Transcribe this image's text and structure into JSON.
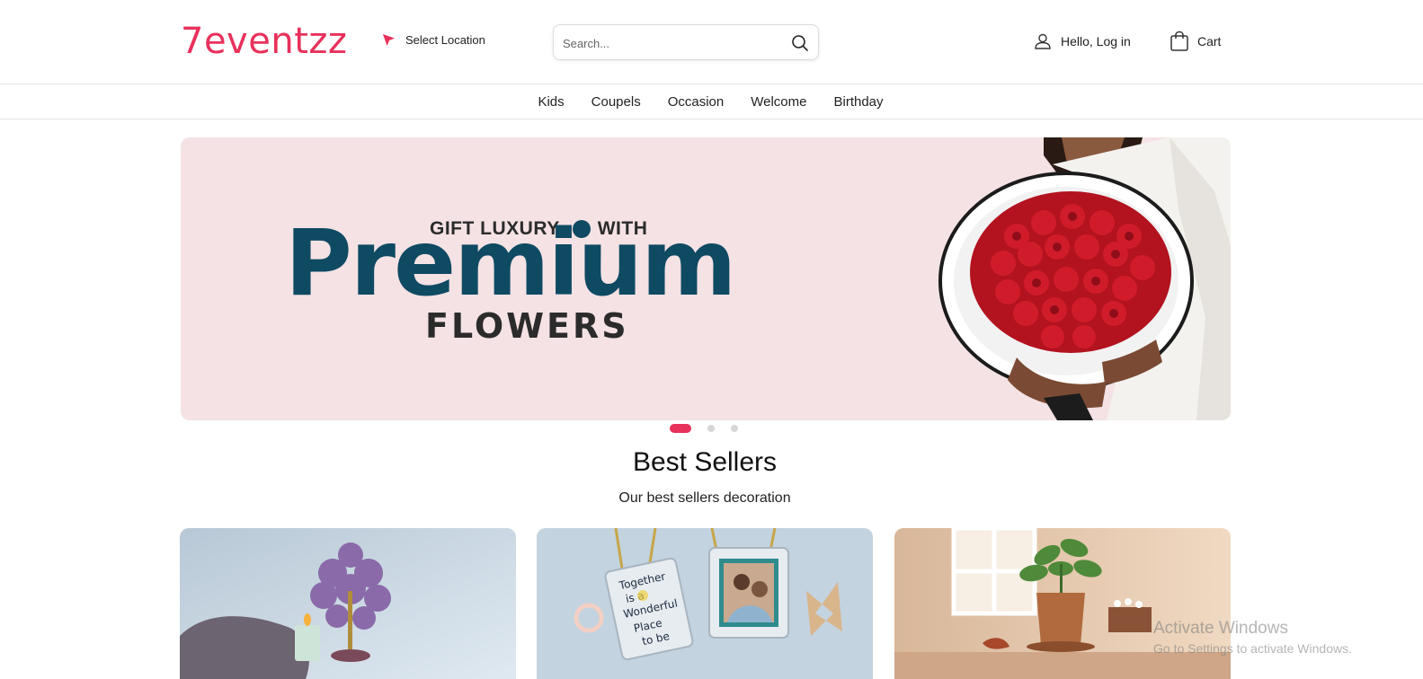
{
  "header": {
    "logo": "7eventzz",
    "location_label": "Select Location",
    "search_placeholder": "Search...",
    "login_label": "Hello, Log in",
    "cart_label": "Cart"
  },
  "nav": {
    "items": [
      "Kids",
      "Coupels",
      "Occasion",
      "Welcome",
      "Birthday"
    ]
  },
  "banner": {
    "tagline_left": "GIFT LUXURY",
    "tagline_right": "WITH",
    "headline": "Premium",
    "subline": "FLOWERS",
    "slide_count": 3,
    "active_slide": 1
  },
  "best_sellers": {
    "title": "Best Sellers",
    "subtitle": "Our best sellers decoration",
    "cards": [
      {
        "image": "gem-tree-candle"
      },
      {
        "image": "photo-frame-together-is-a-wonderful-place-to-be",
        "frame_text": [
          "Together",
          "is a",
          "Wonderful",
          "Place",
          "to be"
        ]
      },
      {
        "image": "potted-plant"
      }
    ]
  },
  "watermark": {
    "title": "Activate Windows",
    "subtitle": "Go to Settings to activate Windows."
  },
  "colors": {
    "brand": "#e8315b",
    "banner_bg": "#f5e2e4",
    "headline": "#0f4a63"
  }
}
